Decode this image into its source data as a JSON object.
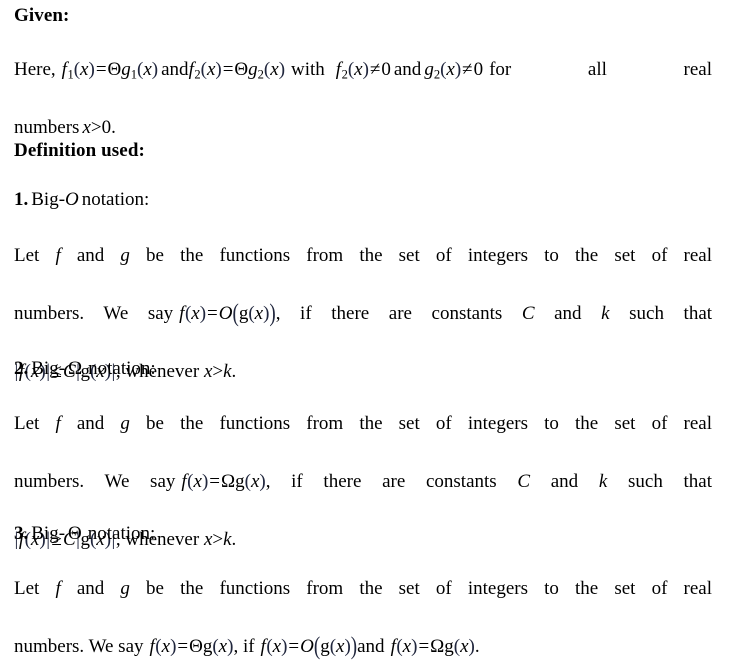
{
  "document": {
    "background_color": "#ffffff",
    "text_color": "#000000",
    "given": {
      "heading": "Given:",
      "body_prefix": "Here,",
      "expr1": {
        "f": "f",
        "sub": "1",
        "lparen": "(",
        "var": "x",
        "rparen": ")",
        "eq": "=",
        "theta": "Θ",
        "g": "g",
        "gsub": "1",
        "glparen": "(",
        "gvar": "x",
        "grparen": ")"
      },
      "and1": "and",
      "expr2": {
        "f": "f",
        "sub": "2",
        "lparen": "(",
        "var": "x",
        "rparen": ")",
        "eq": "=",
        "theta": "Θ",
        "g": "g",
        "gsub": "2",
        "glparen": "(",
        "gvar": "x",
        "grparen": ")"
      },
      "with": "with",
      "expr3": {
        "f": "f",
        "sub": "2",
        "lparen": "(",
        "var": "x",
        "rparen": ")",
        "neq": "≠",
        "zero": "0"
      },
      "and2": "and",
      "expr4": {
        "g": "g",
        "sub": "2",
        "lparen": "(",
        "var": "x",
        "rparen": ")",
        "neq": "≠",
        "zero": "0"
      },
      "tail": "for all real numbers",
      "condition": {
        "var": "x",
        "gt": ">",
        "zero": "0"
      },
      "period": "."
    },
    "definition_heading": "Definition used:",
    "definitions": [
      {
        "number": "1.",
        "title_prefix": "Big-",
        "symbol": "O",
        "symbol_italic": true,
        "title_suffix": "notation:",
        "line1": "Let",
        "var_f": "f",
        "and": "and",
        "var_g": "g",
        "line1_rest": "be the functions from the set of integers to the set of real numbers. We say",
        "formula": {
          "f": "f",
          "lparen": "(",
          "var": "x",
          "rparen": ")",
          "eq": "=",
          "symbol": "O",
          "open": "(",
          "gf": "g",
          "glparen": "(",
          "gvar": "x",
          "grparen": ")",
          "close": ")"
        },
        "line2_rest": ", if there are constants",
        "const_c": "C",
        "and2": "and",
        "const_k": "k",
        "line2_tail": "such that",
        "inequality": {
          "lbar": "|",
          "f": "f",
          "lparen": "(",
          "var": "x",
          "rparen": ")",
          "rbar": "|",
          "rel": "≤",
          "c": "C",
          "lbar2": "|",
          "g": "g",
          "glparen": "(",
          "gvar": "x",
          "grparen": ")",
          "rbar2": "|"
        },
        "whenever": ", whenever",
        "whenever_expr": {
          "var": "x",
          "gt": ">",
          "k": "k"
        },
        "end_period": "."
      },
      {
        "number": "2.",
        "title_prefix": "Big-",
        "symbol": "Ω",
        "symbol_italic": false,
        "title_suffix": "notation:",
        "line1": "Let",
        "var_f": "f",
        "and": "and",
        "var_g": "g",
        "line1_rest": "be the functions from the set of integers to the set of real numbers. We say",
        "formula": {
          "f": "f",
          "lparen": "(",
          "var": "x",
          "rparen": ")",
          "eq": "=",
          "symbol": "Ω",
          "gf": "g",
          "glparen": "(",
          "gvar": "x",
          "grparen": ")"
        },
        "line2_rest": ", if there are constants",
        "const_c": "C",
        "and2": "and",
        "const_k": "k",
        "line2_tail": "such that",
        "inequality": {
          "lbar": "|",
          "f": "f",
          "lparen": "(",
          "var": "x",
          "rparen": ")",
          "rbar": "|",
          "rel": "≥",
          "c": "C",
          "lbar2": "|",
          "g": "g",
          "glparen": "(",
          "gvar": "x",
          "grparen": ")",
          "rbar2": "|"
        },
        "whenever": ", whenever",
        "whenever_expr": {
          "var": "x",
          "gt": ">",
          "k": "k"
        },
        "end_period": "."
      },
      {
        "number": "3.",
        "title_prefix": "Big-",
        "symbol": "Θ",
        "symbol_italic": false,
        "title_suffix": "notation:",
        "line1": "Let",
        "var_f": "f",
        "and": "and",
        "var_g": "g",
        "line1_rest": "be the functions from the set of integers to the set of real numbers. We say",
        "formula": {
          "f": "f",
          "lparen": "(",
          "var": "x",
          "rparen": ")",
          "eq": "=",
          "symbol": "Θ",
          "gf": "g",
          "glparen": "(",
          "gvar": "x",
          "grparen": ")"
        },
        "comma_if": ", if",
        "formula_o": {
          "f": "f",
          "lparen": "(",
          "var": "x",
          "rparen": ")",
          "eq": "=",
          "symbol": "O",
          "open": "(",
          "gf": "g",
          "glparen": "(",
          "gvar": "x",
          "grparen": ")",
          "close": ")"
        },
        "and_mid": "and",
        "formula_omega": {
          "f": "f",
          "lparen": "(",
          "var": "x",
          "rparen": ")",
          "eq": "=",
          "symbol": "Ω",
          "gf": "g",
          "glparen": "(",
          "gvar": "x",
          "grparen": ")"
        },
        "end_period": "."
      }
    ]
  }
}
